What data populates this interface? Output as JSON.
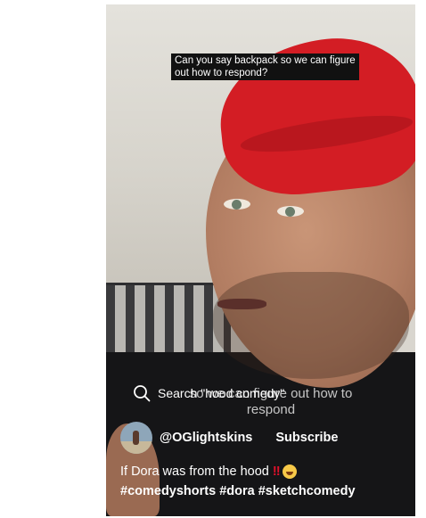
{
  "caption": {
    "line1": "Can you say backpack so we can figure",
    "line2": "out how to respond?"
  },
  "overlay": {
    "ghost_line1": "so we can figure out how to",
    "ghost_line2": "respond"
  },
  "search": {
    "icon": "search-icon",
    "label": "Search \"hood comedy\""
  },
  "channel": {
    "handle": "@OGlightskins",
    "subscribe_label": "Subscribe"
  },
  "video": {
    "title": "If Dora was from the hood",
    "title_mark": "‼",
    "title_emoji": "rolling-on-floor-laughing-emoji",
    "hashtags": "#comedyshorts #dora #sketchcomedy"
  }
}
